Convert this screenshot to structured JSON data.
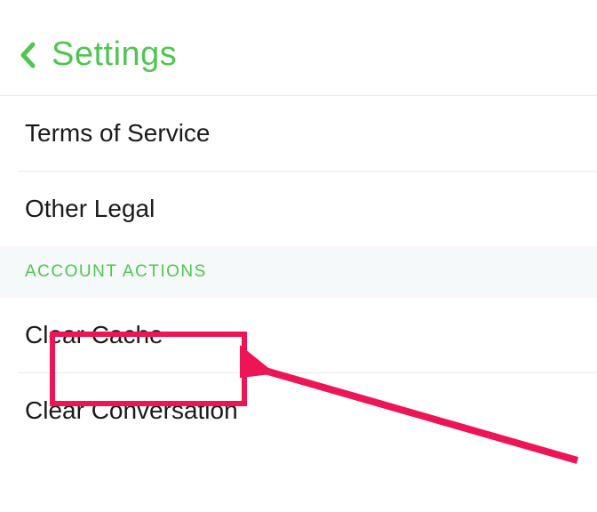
{
  "header": {
    "title": "Settings"
  },
  "items": {
    "terms_of_service": "Terms of Service",
    "other_legal": "Other Legal",
    "clear_cache": "Clear Cache",
    "clear_conversation": "Clear Conversation"
  },
  "section": {
    "account_actions": "ACCOUNT ACTIONS"
  },
  "colors": {
    "accent": "#50c550",
    "highlight": "#ed1556"
  }
}
